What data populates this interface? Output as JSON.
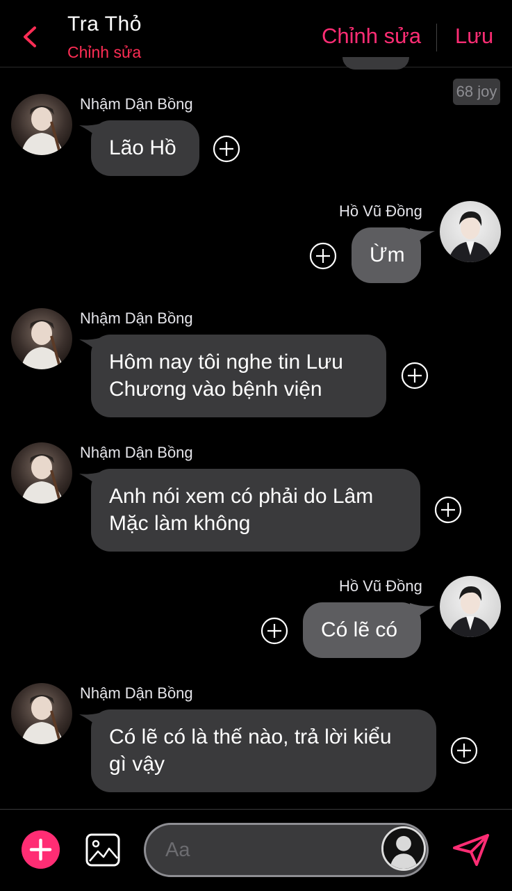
{
  "header": {
    "title": "Tra Thỏ",
    "subtitle": "Chỉnh sửa",
    "edit_label": "Chỉnh sửa",
    "save_label": "Lưu"
  },
  "meta_badge": "68 joy",
  "messages": [
    {
      "side": "left",
      "sender": "Nhậm Dận Bồng",
      "lines": [
        "Lão Hồ"
      ]
    },
    {
      "side": "right",
      "sender": "Hồ Vũ Đồng",
      "lines": [
        "Ừm"
      ]
    },
    {
      "side": "left",
      "sender": "Nhậm Dận Bồng",
      "lines": [
        "Hôm nay tôi nghe tin Lưu",
        "Chương vào bệnh viện"
      ]
    },
    {
      "side": "left",
      "sender": "Nhậm Dận Bồng",
      "lines": [
        "Anh nói xem có phải do Lâm",
        "Mặc làm không"
      ]
    },
    {
      "side": "right",
      "sender": "Hồ Vũ Đồng",
      "lines": [
        "Có lẽ có"
      ]
    },
    {
      "side": "left",
      "sender": "Nhậm Dận Bồng",
      "lines": [
        "Có lẽ có là thế nào, trả lời kiểu",
        "gì vậy"
      ]
    }
  ],
  "composer": {
    "placeholder": "Aa",
    "icons": [
      "plus-icon",
      "image-icon",
      "profile-icon",
      "send-icon"
    ]
  },
  "colors": {
    "accent": "#ff2d74",
    "bubble_left": "#3a3a3c",
    "bubble_right": "#5d5d60",
    "background": "#000000"
  }
}
